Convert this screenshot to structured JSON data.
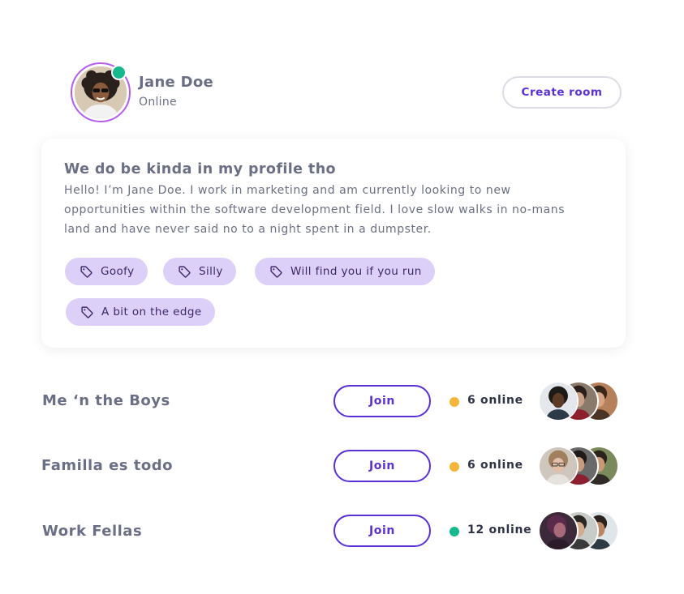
{
  "profile": {
    "name": "Jane Doe",
    "status": "Online",
    "status_color": "#16b98c",
    "ring_color": "#b45cf0",
    "create_room_label": "Create room"
  },
  "bio": {
    "title": "We do be kinda in my profile tho",
    "body": "Hello! I’m Jane Doe. I work in marketing and am currently looking to new opportunities within the software development field. I love slow walks in no-mans land and have never said no to a night spent in a dumpster.",
    "tags": [
      {
        "label": "Goofy",
        "icon": "tag-icon"
      },
      {
        "label": "Silly",
        "icon": "tag-icon"
      },
      {
        "label": "Will find you if you run",
        "icon": "tag-icon"
      },
      {
        "label": "A bit on the edge",
        "icon": "tag-icon"
      }
    ]
  },
  "rooms": [
    {
      "name": "Me ‘n the Boys",
      "join_label": "Join",
      "online_text": "6 online",
      "dot_color": "#f3b43a"
    },
    {
      "name": "Familla es todo",
      "join_label": "Join",
      "online_text": "6 online",
      "dot_color": "#f3b43a"
    },
    {
      "name": "Work Fellas",
      "join_label": "Join",
      "online_text": "12 online",
      "dot_color": "#16b98c"
    }
  ],
  "colors": {
    "accent": "#5b2fd6",
    "tag_bg": "#ddd0f8",
    "text": "#6b6f86"
  }
}
